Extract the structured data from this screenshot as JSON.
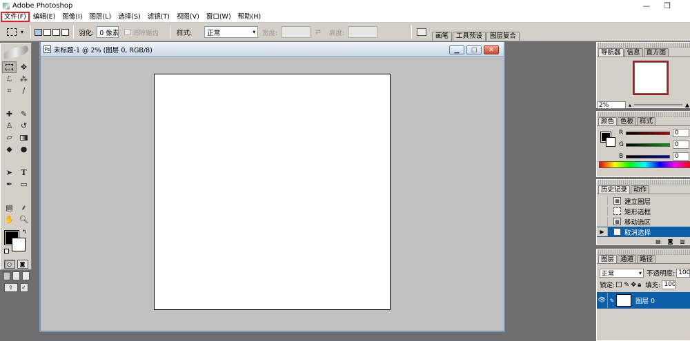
{
  "window": {
    "title": "Adobe Photoshop",
    "minimize": "—",
    "restore": "❐"
  },
  "menu": [
    "文件(F)",
    "编辑(E)",
    "图像(I)",
    "图层(L)",
    "选择(S)",
    "滤镜(T)",
    "视图(V)",
    "窗口(W)",
    "帮助(H)"
  ],
  "options": {
    "feather_label": "羽化:",
    "feather_value": "0 像素",
    "antialias_label": "消除锯齿",
    "style_label": "样式:",
    "style_value": "正常",
    "width_label": "宽度:",
    "height_label": "高度:",
    "swap_icon": "⇄",
    "dock_tabs": [
      "画笔",
      "工具预设",
      "图层复合"
    ]
  },
  "document": {
    "title": "未标题-1 @ 2% (图层 0, RGB/8)"
  },
  "navigator": {
    "tabs": [
      "导航器",
      "信息",
      "直方图"
    ],
    "zoom": "2%"
  },
  "color": {
    "tabs": [
      "颜色",
      "色板",
      "样式"
    ],
    "channels": [
      {
        "label": "R",
        "value": "0",
        "bar_color": "#b00000"
      },
      {
        "label": "G",
        "value": "0",
        "bar_color": "#00a000"
      },
      {
        "label": "B",
        "value": "0",
        "bar_color": "#0000b0"
      }
    ]
  },
  "history": {
    "tabs": [
      "历史记录",
      "动作"
    ],
    "items": [
      "建立图层",
      "矩形选框",
      "移动选区",
      "取消选择"
    ],
    "selected_index": 3
  },
  "layers": {
    "tabs": [
      "图层",
      "通道",
      "路径"
    ],
    "blend_mode": "正常",
    "opacity_label": "不透明度:",
    "opacity_value": "100",
    "lock_label": "锁定:",
    "fill_label": "填充:",
    "fill_value": "100",
    "layer_name": "图层 0"
  },
  "accent": "#0a5fa8"
}
